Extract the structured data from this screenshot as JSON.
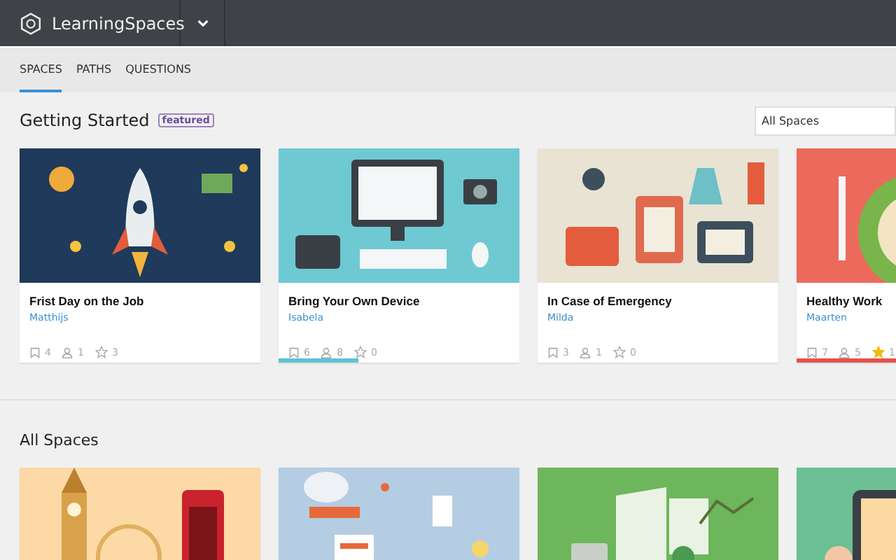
{
  "header": {
    "app_name": "LearningSpaces"
  },
  "tabs": [
    {
      "label": "SPACES",
      "selected": true
    },
    {
      "label": "PATHS",
      "selected": false
    },
    {
      "label": "QUESTIONS",
      "selected": false
    }
  ],
  "featured": {
    "title": "Getting Started",
    "badge": "featured",
    "filter": {
      "value": "All Spaces"
    },
    "cards": [
      {
        "title": "Frist Day on the Job",
        "author": "Matthijs",
        "bookmarks": "4",
        "members": "1",
        "stars": "3",
        "starred": false
      },
      {
        "title": "Bring Your Own Device",
        "author": "Isabela",
        "bookmarks": "6",
        "members": "8",
        "stars": "0",
        "starred": false,
        "progress": {
          "level": 0.33,
          "color": "#5bc4d4"
        }
      },
      {
        "title": "In Case of Emergency",
        "author": "Milda",
        "bookmarks": "3",
        "members": "1",
        "stars": "0",
        "starred": false
      },
      {
        "title": "Healthy Work",
        "author": "Maarten",
        "bookmarks": "7",
        "members": "5",
        "stars": "1",
        "starred": true,
        "progress": {
          "level": 1,
          "color": "#e5534b"
        }
      }
    ]
  },
  "all_spaces": {
    "title": "All Spaces"
  }
}
